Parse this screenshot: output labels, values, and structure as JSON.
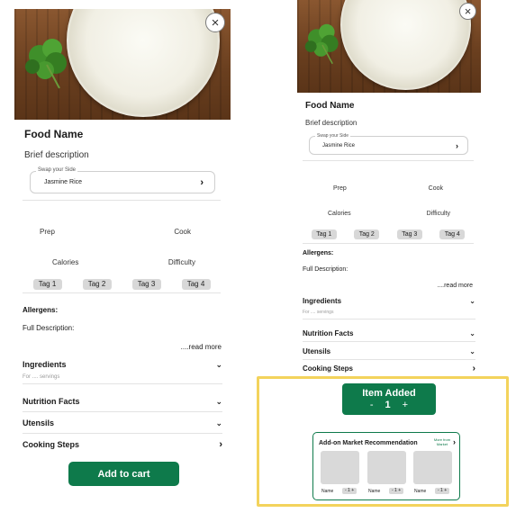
{
  "product": {
    "name": "Food Name",
    "brief": "Brief description",
    "swap": {
      "legend": "Swap your Side",
      "value": "Jasmine Rice"
    },
    "stats": {
      "prep": "Prep",
      "cook": "Cook",
      "calories": "Calories",
      "difficulty": "Difficulty"
    },
    "tags": [
      "Tag 1",
      "Tag 2",
      "Tag 3",
      "Tag 4"
    ],
    "allergens_label": "Allergens:",
    "full_description_label": "Full Description:",
    "read_more": "....read more",
    "sections": [
      {
        "title": "Ingredients",
        "sub": "For .... servings",
        "chevron": "down"
      },
      {
        "title": "Nutrition Facts",
        "chevron": "down"
      },
      {
        "title": "Utensils",
        "chevron": "down"
      },
      {
        "title": "Cooking Steps",
        "chevron": "right"
      }
    ],
    "add_to_cart": "Add to cart"
  },
  "item_added": {
    "label": "Item Added",
    "minus": "-",
    "qty": "1",
    "plus": "+"
  },
  "market": {
    "title": "Add-on Market Recommendation",
    "more": "More from Market",
    "items": [
      {
        "name": "Name",
        "stepper": "- 1 +"
      },
      {
        "name": "Name",
        "stepper": "- 1 +"
      },
      {
        "name": "Name",
        "stepper": "- 1 +"
      }
    ]
  },
  "icons": {
    "close": "close-icon",
    "chevron_right": "chevron-right-icon",
    "chevron_down": "chevron-down-icon"
  },
  "colors": {
    "primary_green": "#0e7a4b",
    "highlight": "#f3d35c",
    "tag_bg": "#d8d8d8"
  }
}
